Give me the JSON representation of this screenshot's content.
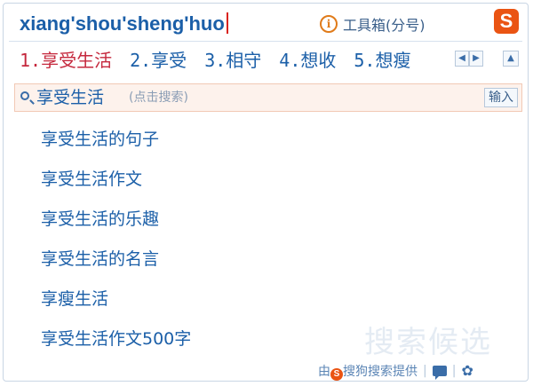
{
  "composition": {
    "pinyin": "xiang'shou'sheng'huo"
  },
  "toolbox": {
    "label": "工具箱(分号)",
    "icon": "info-icon"
  },
  "logo": {
    "glyph": "S",
    "color": "#ea5413"
  },
  "candidates": [
    "1.享受生活",
    "2.享受",
    "3.相守",
    "4.想收",
    "5.想瘦"
  ],
  "pager": {
    "prev": "◀",
    "next": "▶",
    "collapse": "▲"
  },
  "search": {
    "term": "享受生活",
    "hint": "(点击搜索)",
    "input_button": "输入"
  },
  "suggestions": [
    "享受生活的句子",
    "享受生活作文",
    "享受生活的乐趣",
    "享受生活的名言",
    "享瘦生活",
    "享受生活作文500字"
  ],
  "watermark": "搜索候选",
  "footer": {
    "prefix": "由",
    "brand_glyph": "S",
    "provider": "搜狗搜索提供",
    "separator": "|",
    "gear": "✿"
  },
  "colors": {
    "accent": "#1b5fa8",
    "highlight": "#c5283d",
    "brand": "#ea5413"
  }
}
